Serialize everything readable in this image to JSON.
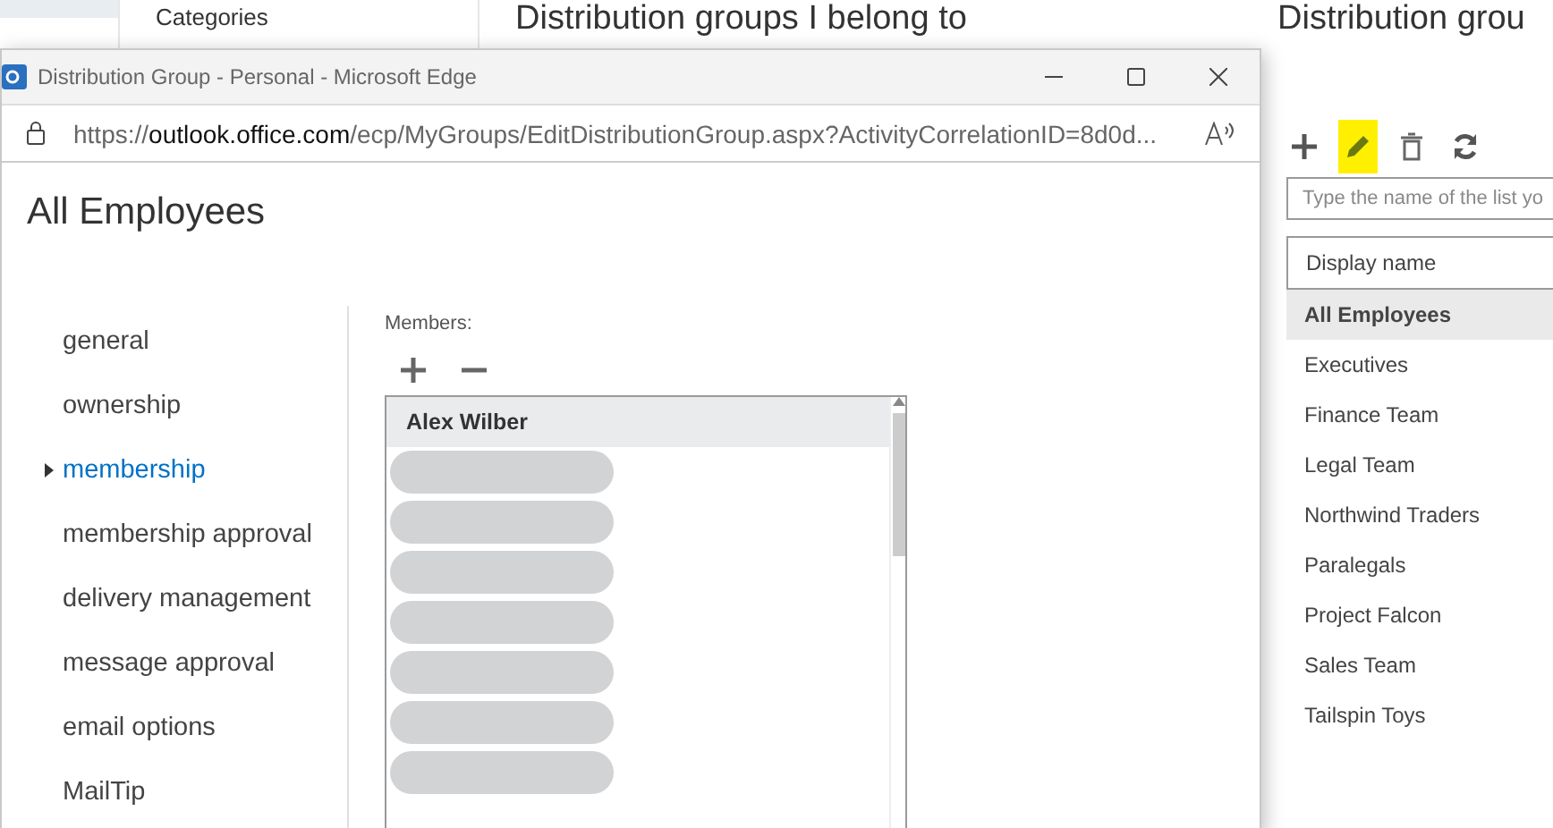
{
  "background_page": {
    "nav_item": "Categories",
    "heading": "Distribution groups I belong to",
    "right_heading": "Distribution grou",
    "toolbar": [
      {
        "kind": "add",
        "highlighted": false
      },
      {
        "kind": "edit",
        "highlighted": true
      },
      {
        "kind": "delete",
        "highlighted": false
      },
      {
        "kind": "refresh",
        "highlighted": false
      }
    ],
    "search": {
      "placeholder": "Type the name of the list yo"
    },
    "table": {
      "columns": [
        "Display name"
      ],
      "rows": [
        {
          "name": "All Employees",
          "selected": true
        },
        {
          "name": "Executives",
          "selected": false
        },
        {
          "name": "Finance Team",
          "selected": false
        },
        {
          "name": "Legal Team",
          "selected": false
        },
        {
          "name": "Northwind Traders",
          "selected": false
        },
        {
          "name": "Paralegals",
          "selected": false
        },
        {
          "name": "Project Falcon",
          "selected": false
        },
        {
          "name": "Sales Team",
          "selected": false
        },
        {
          "name": "Tailspin Toys",
          "selected": false
        }
      ]
    }
  },
  "window": {
    "title": "Distribution Group - Personal - Microsoft Edge",
    "url": {
      "prefix": "https://",
      "host": "outlook.office.com",
      "path": "/ecp/MyGroups/EditDistributionGroup.aspx?ActivityCorrelationID=8d0d..."
    },
    "heading": "All Employees",
    "sections": [
      {
        "label": "general",
        "selected": false
      },
      {
        "label": "ownership",
        "selected": false
      },
      {
        "label": "membership",
        "selected": true
      },
      {
        "label": "membership approval",
        "selected": false
      },
      {
        "label": "delivery management",
        "selected": false
      },
      {
        "label": "message approval",
        "selected": false
      },
      {
        "label": "email options",
        "selected": false
      },
      {
        "label": "MailTip",
        "selected": false
      }
    ],
    "members_label": "Members:",
    "members": [
      {
        "name": "Alex Wilber",
        "selected": true,
        "redacted": false
      },
      {
        "redacted": true,
        "selected": false
      },
      {
        "redacted": true,
        "selected": false
      },
      {
        "redacted": true,
        "selected": false
      },
      {
        "redacted": true,
        "selected": false
      },
      {
        "redacted": true,
        "selected": false
      },
      {
        "redacted": true,
        "selected": false
      },
      {
        "redacted": true,
        "selected": false
      }
    ]
  }
}
